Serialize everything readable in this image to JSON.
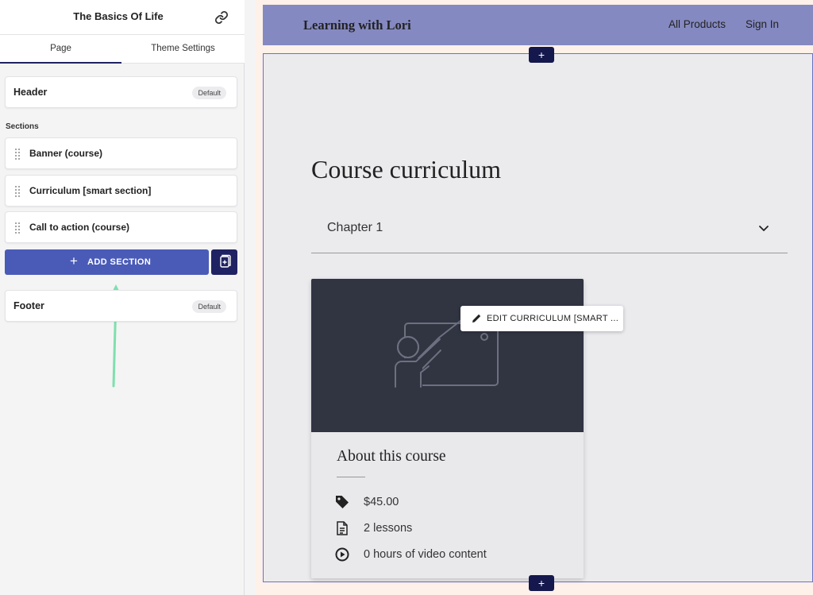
{
  "panel": {
    "title": "The Basics Of Life",
    "tabs": [
      "Page",
      "Theme Settings"
    ],
    "header": {
      "label": "Header",
      "badge": "Default"
    },
    "sections_label": "Sections",
    "sections": [
      {
        "label": "Banner (course)"
      },
      {
        "label": "Curriculum [smart section]"
      },
      {
        "label": "Call to action (course)"
      }
    ],
    "add_section_label": "ADD SECTION",
    "footer": {
      "label": "Footer",
      "badge": "Default"
    }
  },
  "site": {
    "title": "Learning with Lori",
    "nav": [
      "All Products",
      "Sign In"
    ]
  },
  "add_section_tab": "+",
  "curriculum": {
    "title": "Course curriculum",
    "chapter": "Chapter 1",
    "edit_label": "EDIT CURRICULUM [SMART ..."
  },
  "course_card": {
    "title": "About this course",
    "price": "$45.00",
    "lessons": "2 lessons",
    "video": "0 hours of video content"
  },
  "colors": {
    "accent": "#4a5bb7",
    "dark_navy": "#1f2363",
    "header_bg": "#8589c1",
    "arrow": "#7ee0ad"
  },
  "icons": [
    "link-icon",
    "drag-handle-icon",
    "plus-icon",
    "copy-icon",
    "chevron-down-icon",
    "presentation-icon",
    "pencil-icon",
    "price-tag-icon",
    "document-icon",
    "play-circle-icon"
  ]
}
